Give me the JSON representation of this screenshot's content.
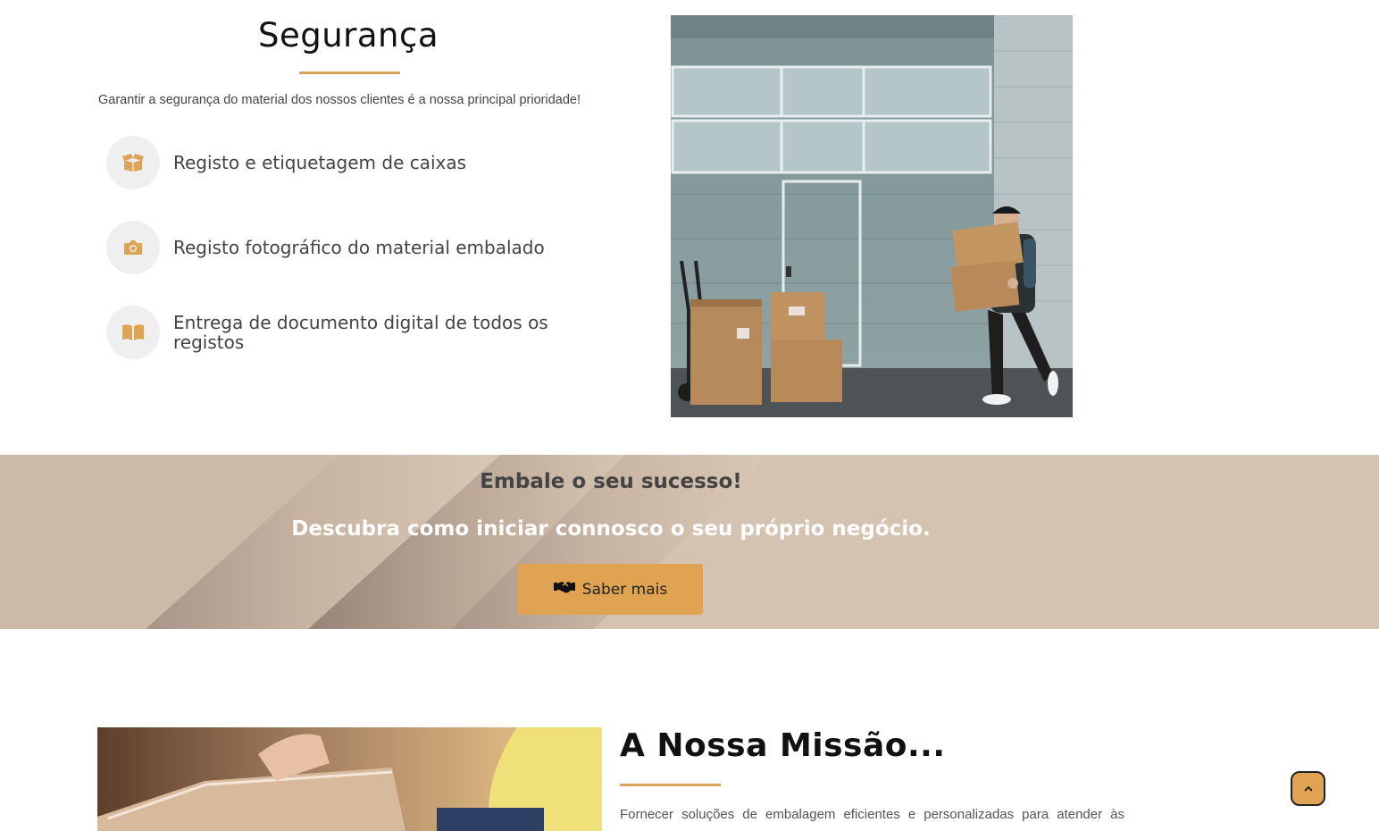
{
  "security": {
    "title": "Segurança",
    "subtitle": "Garantir a segurança do material dos nossos clientes é a nossa principal prioridade!",
    "features": [
      {
        "icon": "box-icon",
        "label": "Registo e etiquetagem de caixas"
      },
      {
        "icon": "camera-icon",
        "label": "Registo fotográfico do material embalado"
      },
      {
        "icon": "book-icon",
        "label": "Entrega de documento digital de todos os registos"
      }
    ],
    "photo": {
      "description_icon": "delivery-man-photo"
    }
  },
  "cta": {
    "heading": "Embale o seu sucesso!",
    "subheading": "Descubra como iniciar connosco o seu próprio negócio.",
    "button_label": "Saber mais",
    "button_icon": "handshake-icon"
  },
  "mission": {
    "title": "A Nossa Missão...",
    "text": "Fornecer soluções de embalagem eficientes e personalizadas para atender às"
  },
  "scroll_top": {
    "icon": "chevron-up-icon"
  },
  "colors": {
    "accent": "#e0a351",
    "underline": "#d9a45c",
    "icon_circle": "#efefef",
    "cta_band": "#d5c3b1"
  }
}
